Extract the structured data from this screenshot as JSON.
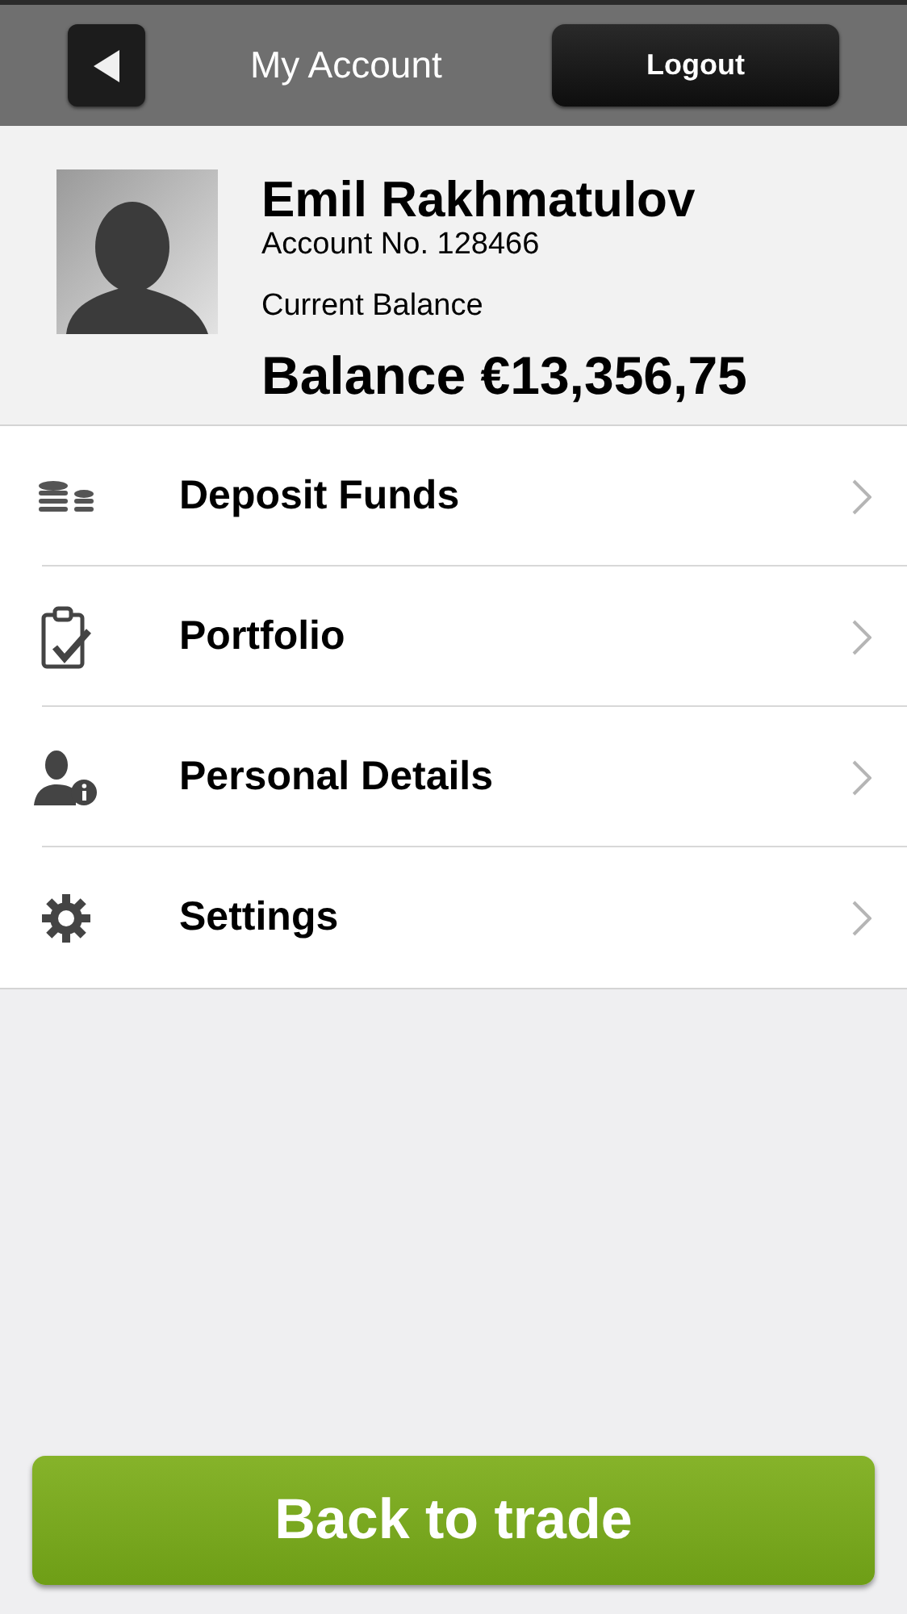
{
  "header": {
    "title": "My Account",
    "logout": "Logout"
  },
  "profile": {
    "name": "Emil Rakhmatulov",
    "account_no": "Account No. 128466",
    "balance_label": "Current Balance",
    "balance": "Balance €13,356,75"
  },
  "menu": [
    {
      "label": "Deposit Funds",
      "kind": "coins"
    },
    {
      "label": "Portfolio",
      "kind": "clipboard"
    },
    {
      "label": "Personal Details",
      "kind": "person"
    },
    {
      "label": "Settings",
      "kind": "gear"
    }
  ],
  "footer": {
    "button": "Back to trade"
  }
}
